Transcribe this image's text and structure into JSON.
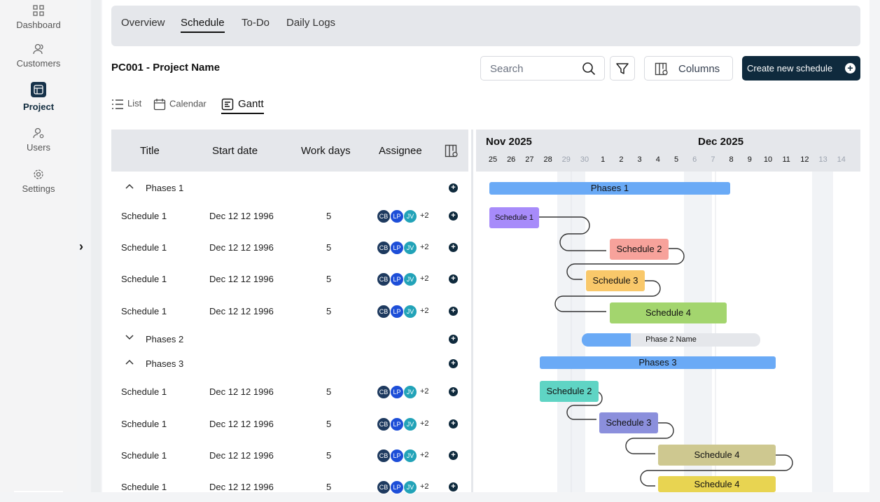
{
  "sidebar": {
    "items": [
      {
        "label": "Dashboard",
        "icon": "grid-icon"
      },
      {
        "label": "Customers",
        "icon": "customers-icon"
      },
      {
        "label": "Project",
        "icon": "project-icon"
      },
      {
        "label": "Users",
        "icon": "users-icon"
      },
      {
        "label": "Settings",
        "icon": "gear-icon"
      }
    ]
  },
  "tabs": [
    "Overview",
    "Schedule",
    "To-Do",
    "Daily Logs"
  ],
  "project": {
    "title": "PC001 - Project Name"
  },
  "toolbar": {
    "search_placeholder": "Search",
    "columns_label": "Columns",
    "create_label": "Create new schedule"
  },
  "views": [
    "List",
    "Calendar",
    "Gantt"
  ],
  "table": {
    "headers": [
      "Title",
      "Start date",
      "Work days",
      "Assignee"
    ],
    "phases": [
      {
        "label": "Phases 1",
        "expanded": true
      },
      {
        "label": "Phases 2",
        "expanded": false
      },
      {
        "label": "Phases 3",
        "expanded": true
      }
    ],
    "rows": [
      {
        "title": "Schedule 1",
        "start": "Dec 12 12 1996",
        "days": "5",
        "more": "+2"
      },
      {
        "title": "Schedule 1",
        "start": "Dec 12 12 1996",
        "days": "5",
        "more": "+2"
      },
      {
        "title": "Schedule 1",
        "start": "Dec 12 12 1996",
        "days": "5",
        "more": "+2"
      },
      {
        "title": "Schedule 1",
        "start": "Dec 12 12 1996",
        "days": "5",
        "more": "+2"
      },
      {
        "title": "Schedule 1",
        "start": "Dec 12 12 1996",
        "days": "5",
        "more": "+2"
      },
      {
        "title": "Schedule 1",
        "start": "Dec 12 12 1996",
        "days": "5",
        "more": "+2"
      },
      {
        "title": "Schedule 1",
        "start": "Dec 12 12 1996",
        "days": "5",
        "more": "+2"
      },
      {
        "title": "Schedule 1",
        "start": "Dec 12 12 1996",
        "days": "5",
        "more": "+2"
      }
    ],
    "avatars": [
      {
        "initials": "CB",
        "color": "#1e3a5f"
      },
      {
        "initials": "LP",
        "color": "#1d4ed8"
      },
      {
        "initials": "JV",
        "color": "#22a3b8"
      }
    ]
  },
  "gantt": {
    "months": [
      "Nov 2025",
      "Dec 2025"
    ],
    "days": [
      "25",
      "26",
      "27",
      "28",
      "29",
      "30",
      "1",
      "2",
      "3",
      "4",
      "5",
      "6",
      "7",
      "8",
      "9",
      "10",
      "11",
      "12",
      "13",
      "14"
    ],
    "bars": {
      "phases1": "Phases 1",
      "s1": "Schedule 1",
      "s2": "Schedule 2",
      "s3": "Schedule 3",
      "s4": "Schedule 4",
      "phase2": "Phase 2 Name",
      "phases3": "Phases 3",
      "p3s2": "Schedule 2",
      "p3s3": "Schedule 3",
      "p3s4": "Schedule 4",
      "p3s4b": "Schedule 4"
    },
    "colors": {
      "phase": "#6aaaf6",
      "s1": "#a78bfa",
      "s2": "#f7a29b",
      "s3": "#f9c86a",
      "s4": "#a3d56e",
      "teal": "#5fd4c4",
      "indigo": "#8b8fdc",
      "olive": "#cec890",
      "yellow": "#e8d451"
    }
  }
}
